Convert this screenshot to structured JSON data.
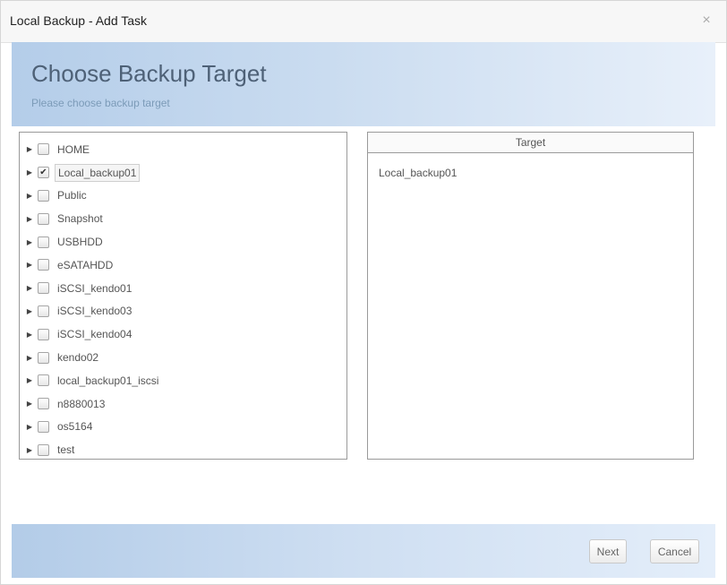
{
  "window": {
    "title": "Local Backup - Add Task",
    "close_glyph": "×"
  },
  "header": {
    "title": "Choose Backup Target",
    "subtitle": "Please choose backup target"
  },
  "tree": {
    "expander_glyph": "▶",
    "check_glyph": "✔",
    "items": [
      {
        "label": "HOME",
        "checked": false
      },
      {
        "label": "Local_backup01",
        "checked": true
      },
      {
        "label": "Public",
        "checked": false
      },
      {
        "label": "Snapshot",
        "checked": false
      },
      {
        "label": "USBHDD",
        "checked": false
      },
      {
        "label": "eSATAHDD",
        "checked": false
      },
      {
        "label": "iSCSI_kendo01",
        "checked": false
      },
      {
        "label": "iSCSI_kendo03",
        "checked": false
      },
      {
        "label": "iSCSI_kendo04",
        "checked": false
      },
      {
        "label": "kendo02",
        "checked": false
      },
      {
        "label": "local_backup01_iscsi",
        "checked": false
      },
      {
        "label": "n8880013",
        "checked": false
      },
      {
        "label": "os5164",
        "checked": false
      },
      {
        "label": "test",
        "checked": false
      }
    ]
  },
  "target": {
    "header": "Target",
    "items": [
      "Local_backup01"
    ]
  },
  "footer": {
    "next_label": "Next",
    "cancel_label": "Cancel"
  }
}
